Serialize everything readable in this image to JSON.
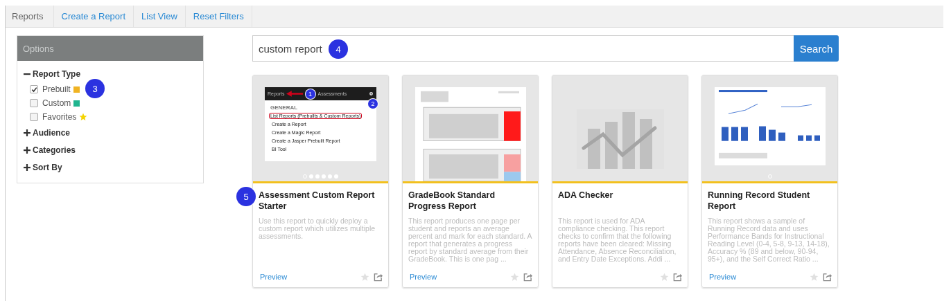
{
  "nav": {
    "title": "Reports",
    "links": [
      "Create a Report",
      "List View",
      "Reset Filters"
    ]
  },
  "sidebar": {
    "header": "Options",
    "callout": "3",
    "sections": [
      {
        "label": "Report Type",
        "expanded": true,
        "options": [
          {
            "label": "Prebuilt",
            "checked": true,
            "kind": "square",
            "color": "#f0b323"
          },
          {
            "label": "Custom",
            "checked": false,
            "kind": "square",
            "color": "#1fb58f"
          },
          {
            "label": "Favorites",
            "checked": false,
            "kind": "star",
            "color": "#f5d400"
          }
        ]
      },
      {
        "label": "Audience",
        "expanded": false
      },
      {
        "label": "Categories",
        "expanded": false
      },
      {
        "label": "Sort By",
        "expanded": false
      }
    ]
  },
  "search": {
    "value": "custom report",
    "button": "Search",
    "callout": "4"
  },
  "cards": [
    {
      "title": "Assessment Custom Report Starter",
      "description": "Use this report to quickly deploy a custom report which utilizes multiple assessments.",
      "preview": "Preview",
      "favorite": false,
      "callout": "5",
      "thumb": {
        "kind": "menu",
        "bar": [
          "Reports",
          "Assessments"
        ],
        "heading": "GENERAL",
        "items": [
          {
            "label": "List Reports (Prebuilts & Custom Reports)",
            "highlighted": true
          },
          {
            "label": "Create a Report",
            "highlighted": false
          },
          {
            "label": "Create a Magic Report",
            "highlighted": false
          },
          {
            "label": "Create a Jasper Prebuilt Report",
            "highlighted": false
          },
          {
            "label": "BI Tool",
            "highlighted": false
          }
        ],
        "callouts": [
          "1",
          "2"
        ]
      },
      "slides": [
        {
          "selected": true
        },
        {
          "selected": false
        },
        {
          "selected": false
        },
        {
          "selected": false
        },
        {
          "selected": false
        },
        {
          "selected": false
        }
      ]
    },
    {
      "title": "GradeBook Standard Progress Report",
      "description": "This report produces one page per student and reports an average percent and mark for each standard. A report that generates a progress report by standard average from their GradeBook. This is one pag ...",
      "preview": "Preview",
      "favorite": false,
      "thumb": {
        "kind": "document"
      }
    },
    {
      "title": "ADA Checker",
      "description": "This report is used for ADA compliance checking. This report checks to confirm that the following reports have been cleared: Missing Attendance, Absence Reconciliation, and Entry Date Exceptions. Addi ...",
      "favorite": false,
      "thumb": {
        "kind": "placeholder"
      }
    },
    {
      "title": "Running Record Student Report",
      "description": "This report shows a sample of Running Record data and uses Performance Bands for Instructional Reading Level (0-4, 5-8, 9-13, 14-18), Accuracy % (89 and below, 90-94, 95+), and the Self Correct Ratio ...",
      "preview": "Preview",
      "favorite": false,
      "thumb": {
        "kind": "report"
      },
      "slides": [
        {
          "selected": true
        }
      ]
    }
  ]
}
